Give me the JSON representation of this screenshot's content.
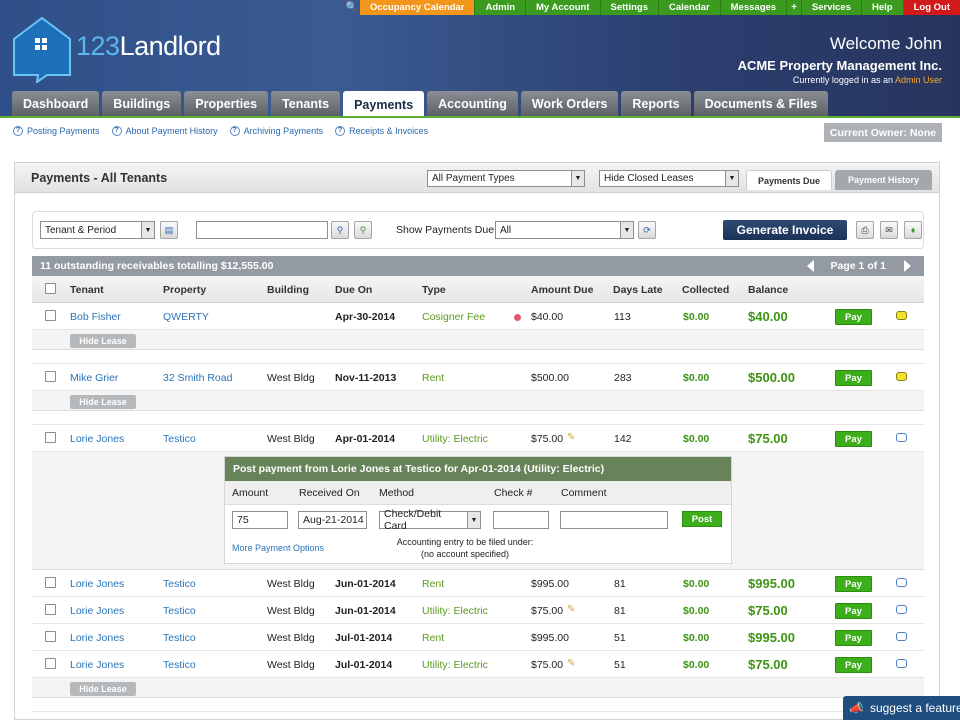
{
  "topnav": [
    "Occupancy Calendar",
    "Admin",
    "My Account",
    "Settings",
    "Calendar",
    "Messages",
    "Services",
    "Help",
    "Log Out"
  ],
  "topnav_plus": "+",
  "logo": {
    "num": "123",
    "word": "Landlord"
  },
  "header": {
    "welcome": "Welcome John",
    "company": "ACME Property Management Inc.",
    "logged_prefix": "Currently logged in as an",
    "logged_role": "Admin User"
  },
  "mainnav": [
    "Dashboard",
    "Buildings",
    "Properties",
    "Tenants",
    "Payments",
    "Accounting",
    "Work Orders",
    "Reports",
    "Documents & Files"
  ],
  "mainnav_active": "Payments",
  "subnav": [
    "Posting Payments",
    "About Payment History",
    "Archiving Payments",
    "Receipts & Invoices"
  ],
  "owner_badge": "Current Owner: None",
  "panel": {
    "title": "Payments - All Tenants",
    "payment_type": "All Payment Types",
    "lease_filter": "Hide Closed Leases",
    "tab_due": "Payments Due",
    "tab_history": "Payment History"
  },
  "toolbar": {
    "tenant_period": "Tenant & Period",
    "show_label": "Show Payments Due:",
    "show_value": "All",
    "generate": "Generate Invoice"
  },
  "summary": {
    "text": "11 outstanding receivables totalling $12,555.00",
    "pager": "Page 1 of 1"
  },
  "columns": [
    "Tenant",
    "Property",
    "Building",
    "Due On",
    "Type",
    "Amount Due",
    "Days Late",
    "Collected",
    "Balance"
  ],
  "rows": [
    {
      "tenant": "Bob Fisher",
      "property": "QWERTY",
      "building": "",
      "due": "Apr-30-2014",
      "type": "Cosigner Fee",
      "amount": "$40.00",
      "late": "113",
      "collected": "$0.00",
      "balance": "$40.00",
      "pay": "Pay"
    },
    {
      "tenant": "Mike Grier",
      "property": "32 Smith Road",
      "building": "West Bldg",
      "due": "Nov-11-2013",
      "type": "Rent",
      "amount": "$500.00",
      "late": "283",
      "collected": "$0.00",
      "balance": "$500.00",
      "pay": "Pay"
    },
    {
      "tenant": "Lorie Jones",
      "property": "Testico",
      "building": "West Bldg",
      "due": "Apr-01-2014",
      "type": "Utility: Electric",
      "amount": "$75.00",
      "late": "142",
      "collected": "$0.00",
      "balance": "$75.00",
      "pay": "Pay"
    },
    {
      "tenant": "Lorie Jones",
      "property": "Testico",
      "building": "West Bldg",
      "due": "Jun-01-2014",
      "type": "Rent",
      "amount": "$995.00",
      "late": "81",
      "collected": "$0.00",
      "balance": "$995.00",
      "pay": "Pay"
    },
    {
      "tenant": "Lorie Jones",
      "property": "Testico",
      "building": "West Bldg",
      "due": "Jun-01-2014",
      "type": "Utility: Electric",
      "amount": "$75.00",
      "late": "81",
      "collected": "$0.00",
      "balance": "$75.00",
      "pay": "Pay"
    },
    {
      "tenant": "Lorie Jones",
      "property": "Testico",
      "building": "West Bldg",
      "due": "Jul-01-2014",
      "type": "Rent",
      "amount": "$995.00",
      "late": "51",
      "collected": "$0.00",
      "balance": "$995.00",
      "pay": "Pay"
    },
    {
      "tenant": "Lorie Jones",
      "property": "Testico",
      "building": "West Bldg",
      "due": "Jul-01-2014",
      "type": "Utility: Electric",
      "amount": "$75.00",
      "late": "51",
      "collected": "$0.00",
      "balance": "$75.00",
      "pay": "Pay"
    }
  ],
  "hide_lease": "Hide Lease",
  "post": {
    "title": "Post payment from Lorie Jones at Testico for Apr-01-2014 (Utility: Electric)",
    "headers": [
      "Amount",
      "Received On",
      "Method",
      "Check #",
      "Comment"
    ],
    "amount": "75",
    "received": "Aug-21-2014",
    "method": "Check/Debit Card",
    "button": "Post",
    "more": "More Payment Options",
    "note1": "Accounting entry to be filed under:",
    "note2": "(no account specified)"
  },
  "suggest": "suggest a feature",
  "colors": {
    "green": "#3cae1a",
    "orange": "#f2951b",
    "red": "#d11b1b",
    "navy": "#1b3256",
    "header_green": "#688359"
  }
}
